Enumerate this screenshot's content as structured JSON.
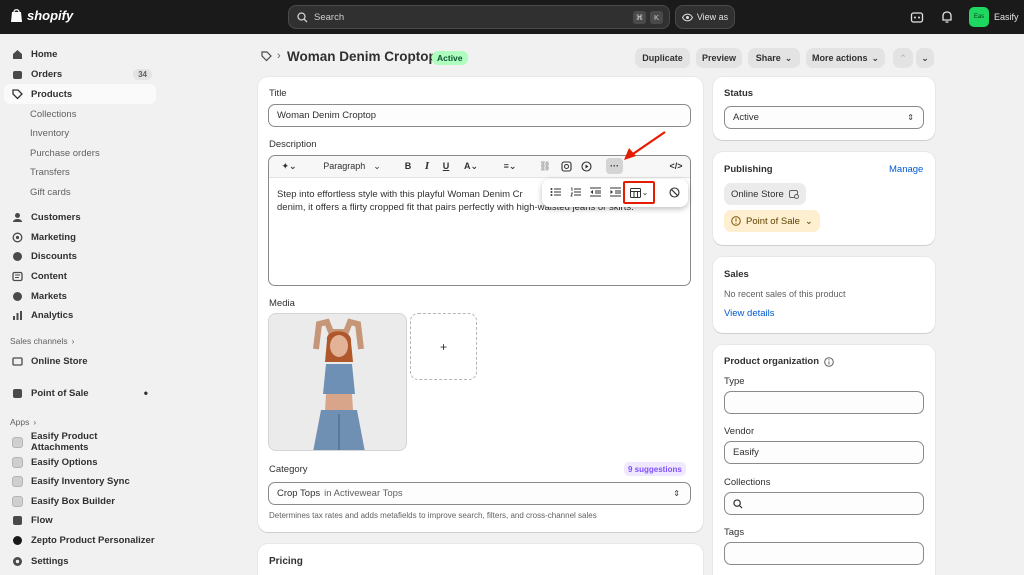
{
  "topbar": {
    "brand": "shopify",
    "search_placeholder": "Search",
    "kbd_cmd": "⌘",
    "kbd_k": "K",
    "view_as": "View as",
    "store_name": "Easify",
    "avatar_initials": "Eas"
  },
  "sidebar": {
    "home": "Home",
    "orders": "Orders",
    "orders_count": "34",
    "products": "Products",
    "collections": "Collections",
    "inventory": "Inventory",
    "purchase_orders": "Purchase orders",
    "transfers": "Transfers",
    "gift_cards": "Gift cards",
    "customers": "Customers",
    "marketing": "Marketing",
    "discounts": "Discounts",
    "content": "Content",
    "markets": "Markets",
    "analytics": "Analytics",
    "sales_channels": "Sales channels",
    "online_store": "Online Store",
    "point_of_sale": "Point of Sale",
    "apps": "Apps",
    "app_items": [
      "Easify Product Attachments",
      "Easify Options",
      "Easify Inventory Sync",
      "Easify Box Builder",
      "Flow",
      "Zepto Product Personalizer"
    ],
    "settings": "Settings"
  },
  "header": {
    "title": "Woman Denim Croptop",
    "status_badge": "Active",
    "duplicate": "Duplicate",
    "preview": "Preview",
    "share": "Share",
    "more_actions": "More actions"
  },
  "product": {
    "title_label": "Title",
    "title_value": "Woman Denim Croptop",
    "description_label": "Description",
    "paragraph_style": "Paragraph",
    "description_line1": "Step into effortless style with this playful Woman Denim Cr",
    "description_line2": "denim, it offers a flirty cropped fit that pairs perfectly with high-waisted jeans or skirts.",
    "media_label": "Media",
    "add_media": "+",
    "category_label": "Category",
    "suggestions": "9 suggestions",
    "category_value": "Crop Tops",
    "category_suffix": "in Activewear Tops",
    "category_help": "Determines tax rates and adds metafields to improve search, filters, and cross-channel sales",
    "pricing_label": "Pricing"
  },
  "status_card": {
    "label": "Status",
    "value": "Active"
  },
  "publishing": {
    "label": "Publishing",
    "manage": "Manage",
    "online_store": "Online Store",
    "point_of_sale": "Point of Sale"
  },
  "sales": {
    "label": "Sales",
    "message": "No recent sales of this product",
    "view_details": "View details"
  },
  "organization": {
    "label": "Product organization",
    "type_label": "Type",
    "type_value": "",
    "vendor_label": "Vendor",
    "vendor_value": "Easify",
    "collections_label": "Collections",
    "collections_value": "",
    "tags_label": "Tags",
    "tags_value": ""
  },
  "colors": {
    "topbar": "#1a1a1a",
    "active_badge": "#affebf",
    "link": "#005bd3",
    "highlight": "#e51c00",
    "pos_pill": "#ffefd1",
    "suggestion_bg": "#f0e8ff"
  }
}
